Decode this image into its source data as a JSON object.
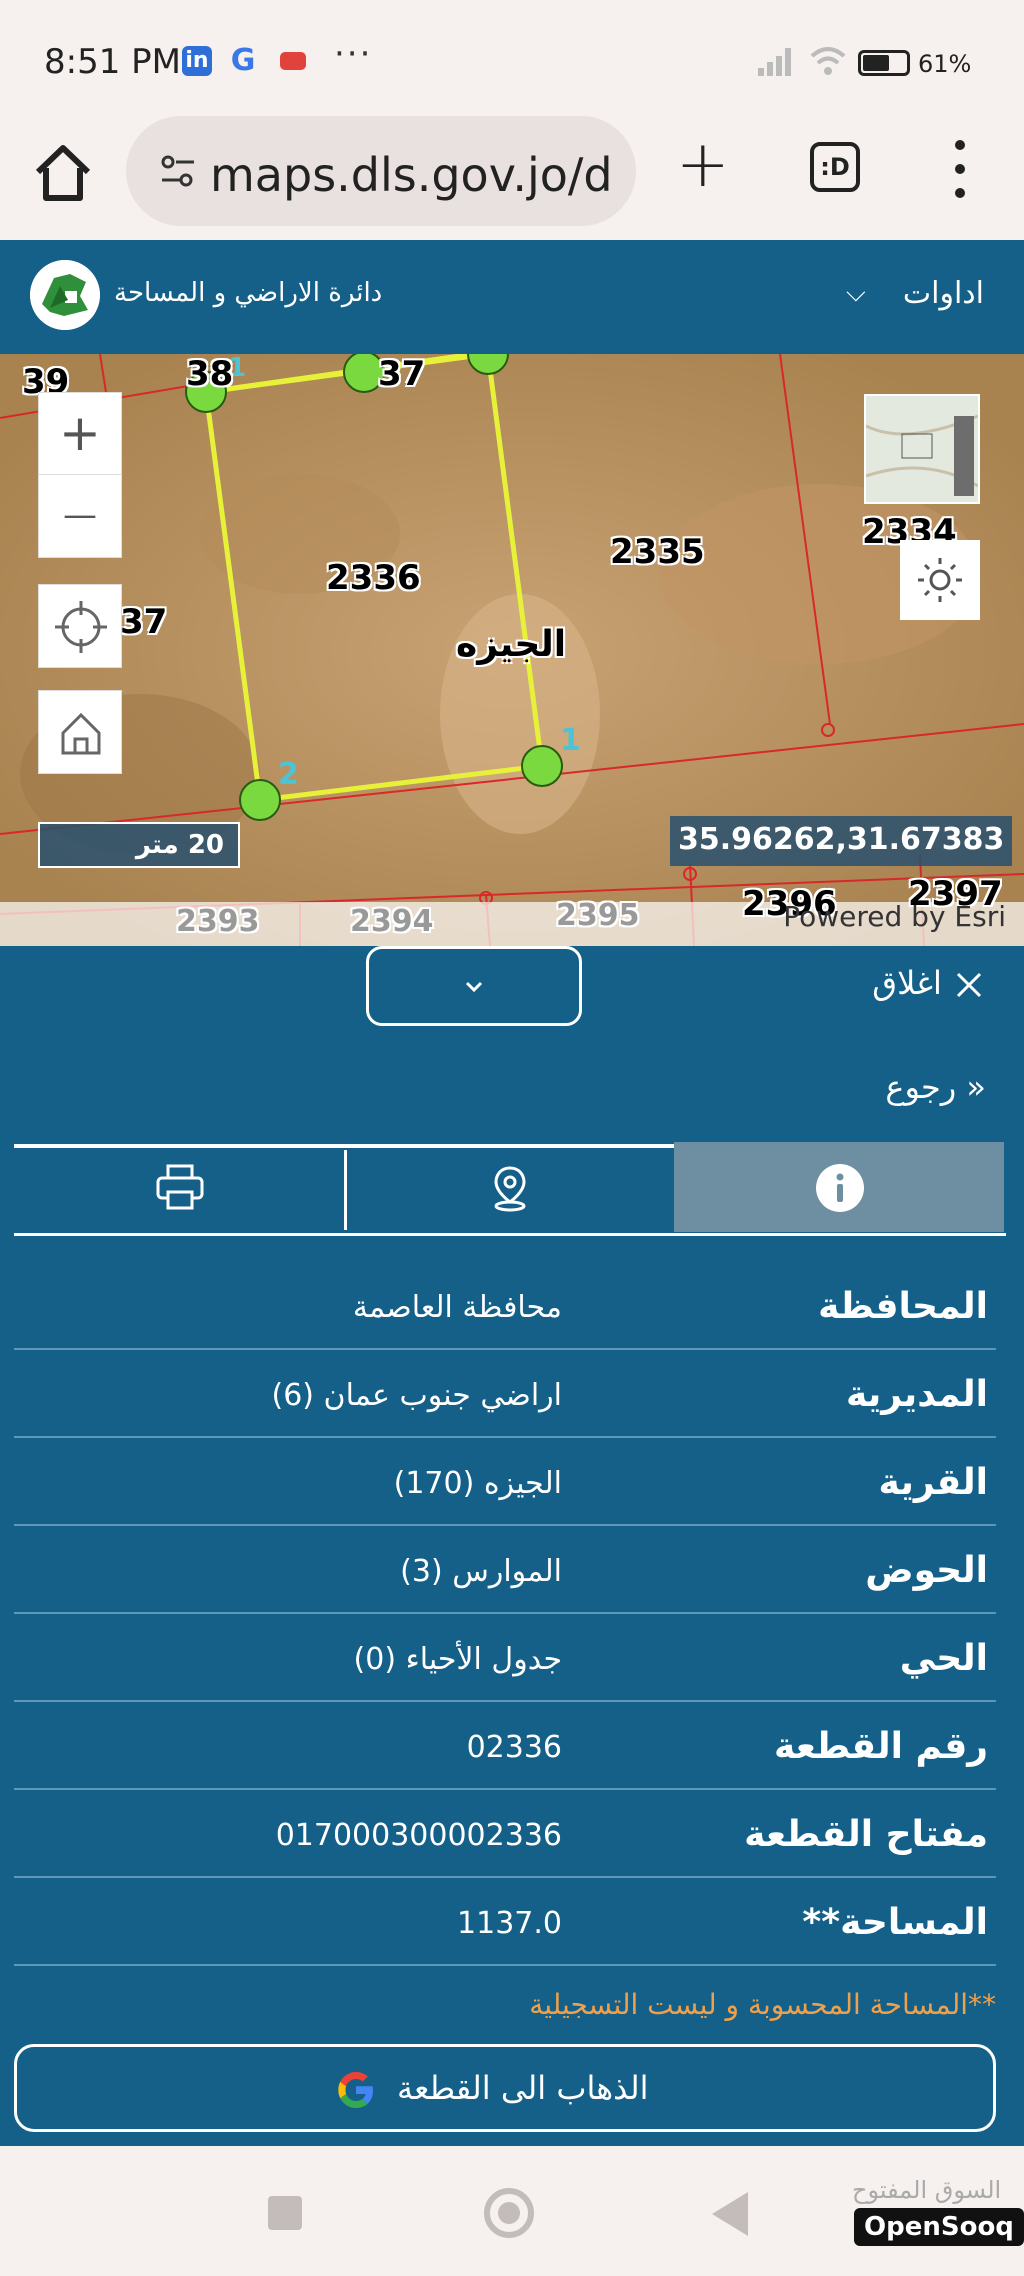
{
  "status_bar": {
    "time": "8:51 PM",
    "app_icons": [
      "linkedin-icon",
      "google-icon",
      "youtube-icon"
    ],
    "more": "···",
    "battery_percent": "61%"
  },
  "browser": {
    "url": "maps.dls.gov.jo/d",
    "tab_label": ":D"
  },
  "header": {
    "department_name": "دائرة الاراضي و المساحة",
    "tools_label": "اداوات"
  },
  "map": {
    "parcels": {
      "p2336": "2336",
      "p2335": "2335",
      "p2334": "2334",
      "p39": "39",
      "p38": "38",
      "p37a": "37",
      "p37b": "37",
      "p2393": "2393",
      "p2394": "2394",
      "p2395": "2395",
      "p2396": "2396",
      "p2397": "2397"
    },
    "vertex_labels": {
      "v1": "1",
      "v2": "2"
    },
    "village_label": "الجيزه",
    "scale_label": "20 متر",
    "coordinates": "35.96262,31.67383",
    "credit": "Powered by Esri",
    "zoom_in": "+",
    "zoom_out": "—",
    "colors": {
      "boundary": "#e8f13a",
      "vertex": "#79d93e",
      "grid": "#d8282a"
    }
  },
  "panel": {
    "close_label": "اغلاق",
    "back_label": "رجوع",
    "tabs": [
      "info-icon",
      "location-pin-icon",
      "printer-icon"
    ],
    "rows": [
      {
        "label": "المحافظة",
        "value": "محافظة العاصمة"
      },
      {
        "label": "المديرية",
        "value": "اراضي جنوب عمان (6)"
      },
      {
        "label": "القرية",
        "value": "الجيزه (170)"
      },
      {
        "label": "الحوض",
        "value": "الموارس (3)"
      },
      {
        "label": "الحي",
        "value": "جدول الأحياء (0)"
      },
      {
        "label": "رقم القطعة",
        "value": "02336"
      },
      {
        "label": "مفتاح القطعة",
        "value": "017000300002336"
      },
      {
        "label": "المساحة**",
        "value": "1137.0"
      }
    ],
    "area_note": "**المساحة المحسوبة و ليست التسجيلية",
    "go_button": "الذهاب الى القطعة"
  },
  "watermark": {
    "arabic": "السوق المفتوح",
    "brand": "OpenSooq"
  }
}
